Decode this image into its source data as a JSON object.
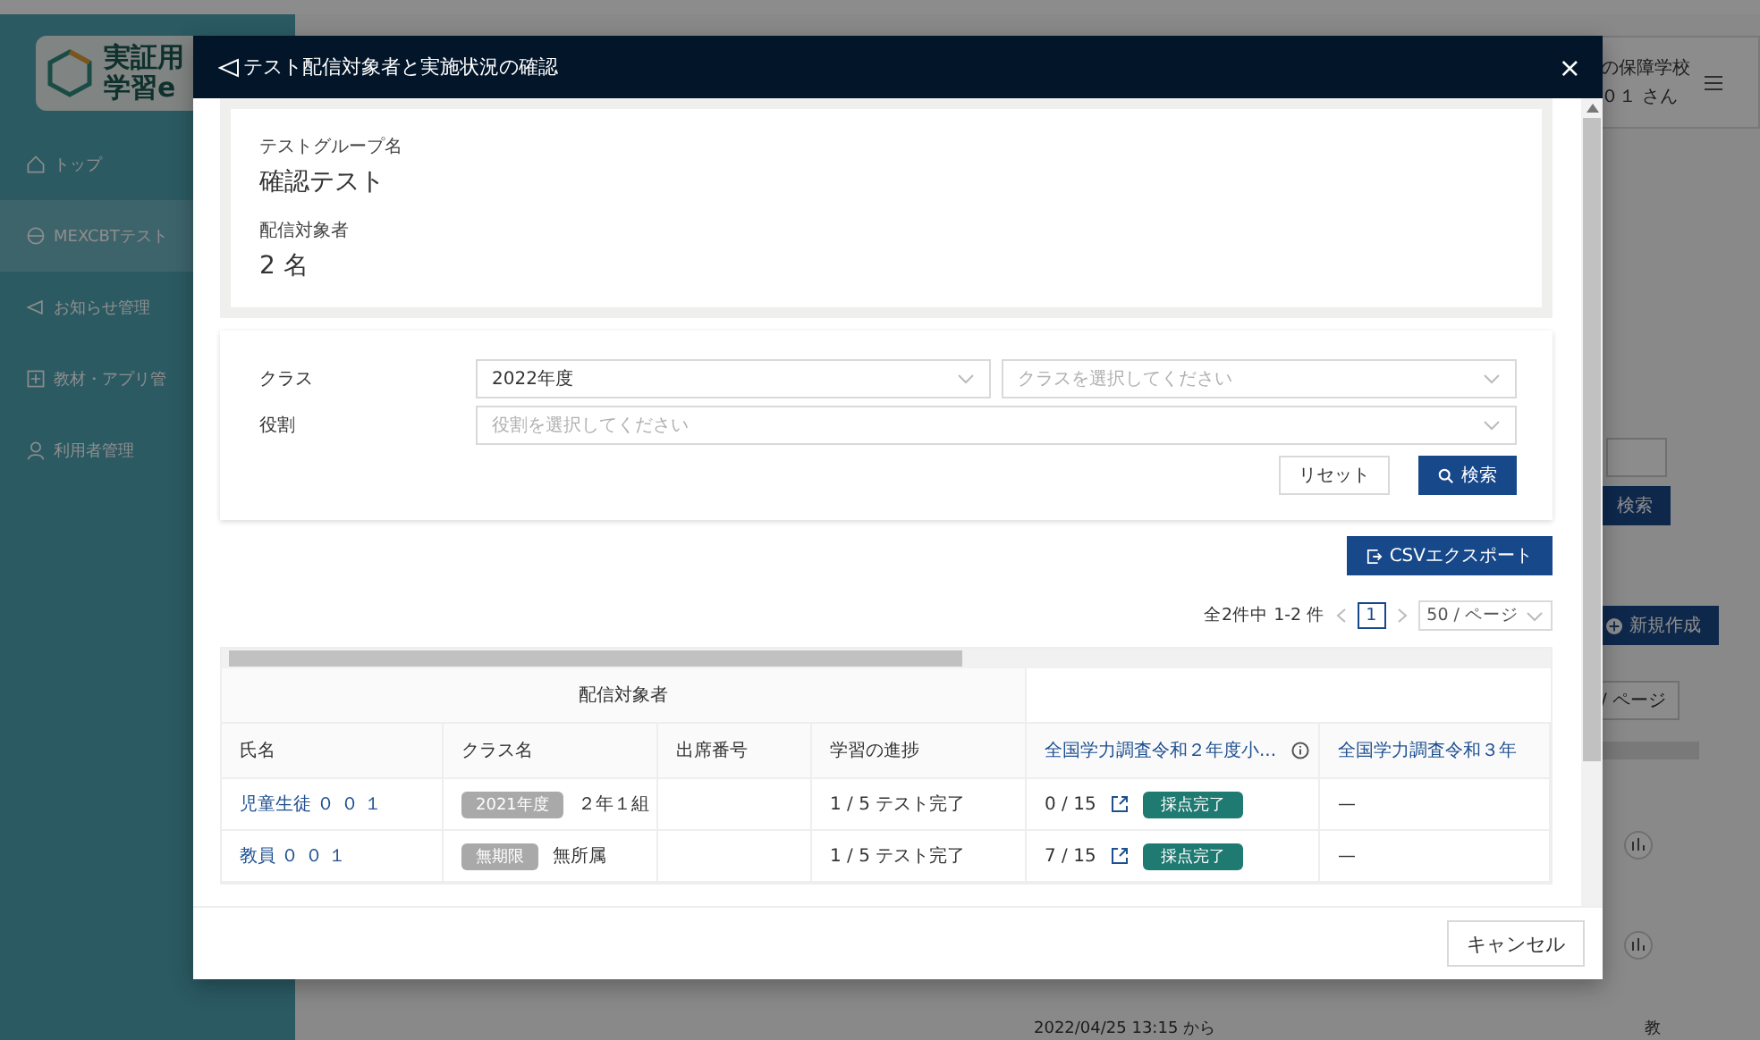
{
  "background": {
    "logo": {
      "line1": "実証用",
      "line2": "学習e"
    },
    "nav": [
      {
        "label": "トップ",
        "selected": false
      },
      {
        "label": "MEXCBTテスト",
        "selected": true
      },
      {
        "label": "お知らせ管理",
        "selected": false
      },
      {
        "label": "教材・アプリ管",
        "selected": false
      },
      {
        "label": "利用者管理",
        "selected": false
      }
    ],
    "header": {
      "school": "の保障学校",
      "user": "０１ さん"
    },
    "search_button": "検索",
    "create_button": "新規作成",
    "page_size": "/ ページ",
    "date": "2022/04/25 13:15 から",
    "row_label": "教"
  },
  "dialog": {
    "title": "テスト配信対象者と実施状況の確認",
    "close": "×",
    "summary": {
      "group_label": "テストグループ名",
      "group_value": "確認テスト",
      "target_label": "配信対象者",
      "target_value": "2 名"
    },
    "filters": {
      "class_label": "クラス",
      "year_value": "2022年度",
      "class_placeholder": "クラスを選択してください",
      "role_label": "役割",
      "role_placeholder": "役割を選択してください",
      "reset_button": "リセット",
      "search_button": "検索"
    },
    "export_button": "CSVエクスポート",
    "pagination": {
      "summary": "全2件中 1-2 件",
      "pages": [
        {
          "label": "1",
          "selected": true
        }
      ],
      "page_size": "50 / ページ"
    },
    "table": {
      "group_header": "配信対象者",
      "columns": [
        {
          "label": "氏名",
          "kind": "plain"
        },
        {
          "label": "クラス名",
          "kind": "plain"
        },
        {
          "label": "出席番号",
          "kind": "plain"
        },
        {
          "label": "学習の進捗",
          "kind": "plain"
        },
        {
          "label": "全国学力調査令和２年度小...",
          "kind": "test",
          "info": true
        },
        {
          "label": "全国学力調査令和３年",
          "kind": "test",
          "info": false
        }
      ],
      "rows": [
        {
          "name": "児童生徒 ０ ０ １",
          "class_tag": "2021年度",
          "class_name": "２年１組",
          "progress": "1 / 5 テスト完了",
          "score": "0 / 15",
          "status": "採点完了",
          "column_6": "—"
        },
        {
          "name": "教員 ０ ０ １",
          "class_tag": "無期限",
          "class_name": "無所属",
          "progress": "1 / 5 テスト完了",
          "score": "7 / 15",
          "status": "採点完了",
          "column_6": "—"
        }
      ]
    },
    "cancel_button": "キャンセル"
  }
}
